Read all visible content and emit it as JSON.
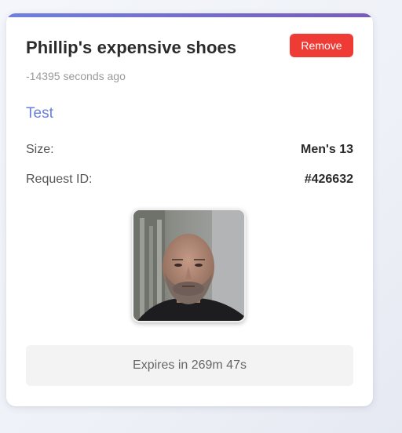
{
  "card": {
    "title": "Phillip's expensive shoes",
    "remove_label": "Remove",
    "timestamp": "-14395 seconds ago",
    "description": "Test",
    "details": [
      {
        "label": "Size:",
        "value": "Men's 13"
      },
      {
        "label": "Request ID:",
        "value": "#426632"
      }
    ],
    "expires": "Expires in 269m 47s",
    "colors": {
      "accent_gradient_start": "#6f7fe0",
      "accent_gradient_end": "#7a5bb8",
      "remove_button": "#ef3b35",
      "description_text": "#6a7fd8"
    }
  }
}
